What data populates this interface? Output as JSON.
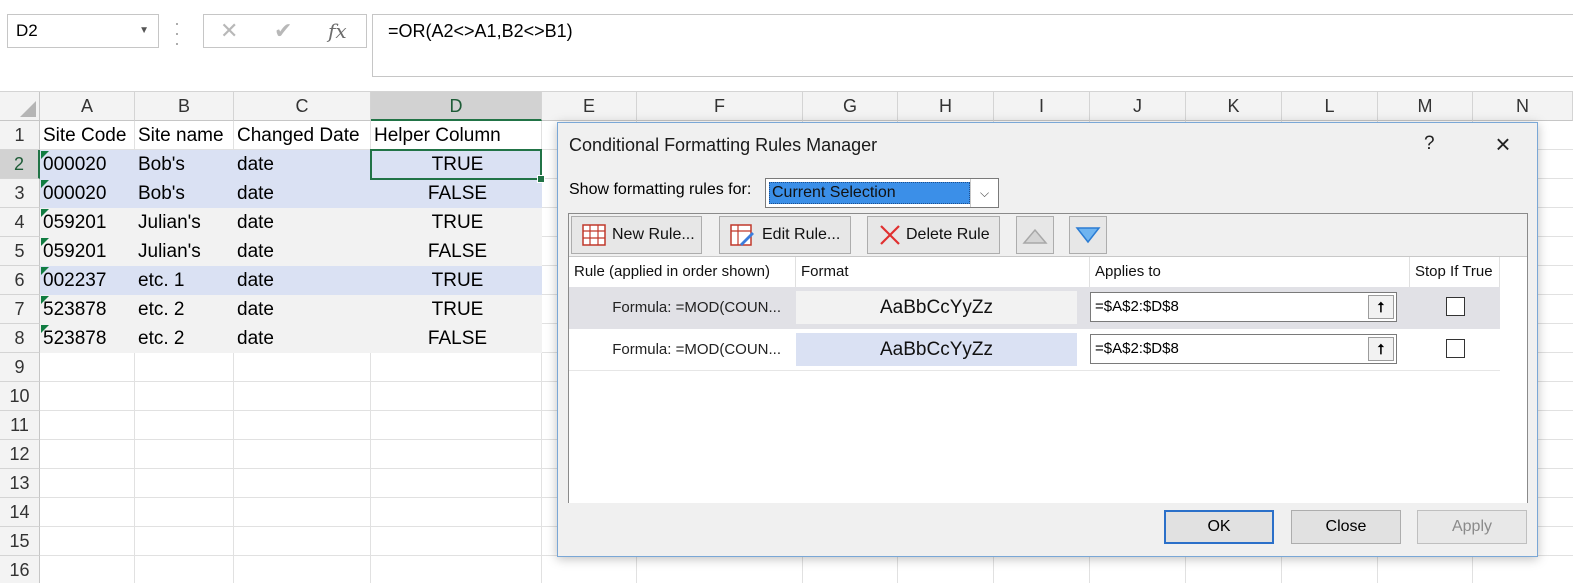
{
  "formula_bar": {
    "name_box": "D2",
    "cancel_icon": "x-icon",
    "enter_icon": "check-icon",
    "function_icon": "fx",
    "formula": "=OR(A2<>A1,B2<>B1)"
  },
  "sheet": {
    "columns": [
      "A",
      "B",
      "C",
      "D",
      "E",
      "F",
      "G",
      "H",
      "I",
      "J",
      "K",
      "L",
      "M",
      "N"
    ],
    "selected_column": "D",
    "rows": [
      "1",
      "2",
      "3",
      "4",
      "5",
      "6",
      "7",
      "8",
      "9",
      "10",
      "11",
      "12",
      "13",
      "14",
      "15",
      "16"
    ],
    "selected_row": "2",
    "active_cell": "D2",
    "band_color": "#dae1f3",
    "alt_color": "#f2f2f2",
    "data": [
      [
        "Site Code",
        "Site name",
        "Changed Date",
        "Helper Column"
      ],
      [
        "000020",
        "Bob's",
        "date",
        "TRUE"
      ],
      [
        "000020",
        "Bob's",
        "date",
        "FALSE"
      ],
      [
        "059201",
        "Julian's",
        "date",
        "TRUE"
      ],
      [
        "059201",
        "Julian's",
        "date",
        "FALSE"
      ],
      [
        "002237",
        "etc. 1",
        "date",
        "TRUE"
      ],
      [
        "523878",
        "etc. 2",
        "date",
        "TRUE"
      ],
      [
        "523878",
        "etc. 2",
        "date",
        "FALSE"
      ]
    ]
  },
  "dialog": {
    "title": "Conditional Formatting Rules Manager",
    "help": "?",
    "close": "×",
    "show_label": "Show formatting rules for:",
    "show_value": "Current Selection",
    "buttons": {
      "new_rule": "New Rule...",
      "edit_rule": "Edit Rule...",
      "delete_rule": "Delete Rule",
      "move_up_icon": "triangle-up-icon",
      "move_down_icon": "triangle-down-icon"
    },
    "columns": {
      "rule": "Rule (applied in order shown)",
      "format": "Format",
      "applies_to": "Applies to",
      "stop_if_true": "Stop If True"
    },
    "rules": [
      {
        "rule": "Formula: =MOD(COUN...",
        "format": "AaBbCcYyZz",
        "format_bg": "#f2f2f2",
        "applies_to": "=$A$2:$D$8",
        "stop_if_true": false
      },
      {
        "rule": "Formula: =MOD(COUN...",
        "format": "AaBbCcYyZz",
        "format_bg": "#dae1f3",
        "applies_to": "=$A$2:$D$8",
        "stop_if_true": false
      }
    ],
    "footer": {
      "ok": "OK",
      "close": "Close",
      "apply": "Apply"
    }
  }
}
